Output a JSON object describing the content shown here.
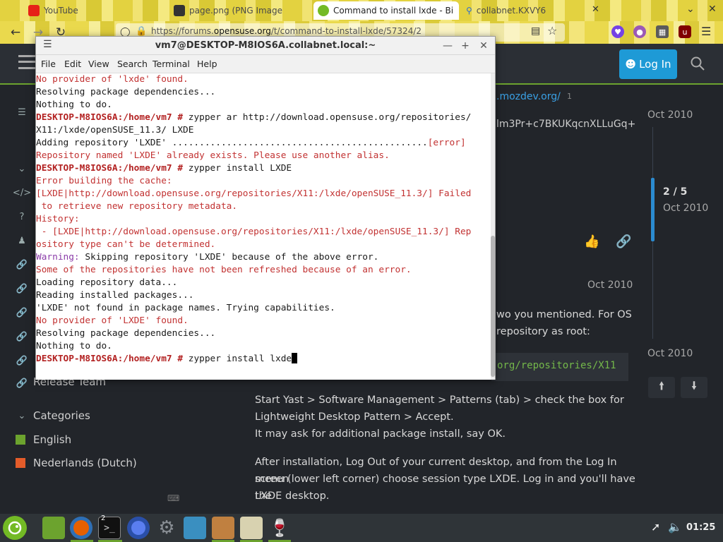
{
  "browser": {
    "tabs": [
      {
        "label": "YouTube",
        "icon": "youtube-icon",
        "active": false
      },
      {
        "label": "page.png (PNG Image",
        "icon": "image-icon",
        "active": false
      },
      {
        "label": "Command to install lxde - Bi",
        "icon": "opensuse-icon",
        "active": true
      },
      {
        "label": "collabnet.KXVY6",
        "icon": "search-icon",
        "active": false
      }
    ],
    "url_prefix": "https://forums.",
    "url_domain": "opensuse.org",
    "url_suffix": "/t/command-to-install-lxde/57324/2"
  },
  "forum": {
    "login_label": "Log In",
    "fragment_link": ".mozdev.org/",
    "fragment_link_count": "1",
    "fragment_key": "lm3Pr+c7BKUKqcnXLLuGq+",
    "timeline_date_top": "Oct 2010",
    "timeline_position": "2 / 5",
    "timeline_position_date": "Oct 2010",
    "post_date": "Oct 2010",
    "timeline_date_bottom": "Oct 2010",
    "frag_line1": "wo you mentioned. For OS",
    "frag_line2": "repository as root:",
    "code_fragment": "org/repositories/X11",
    "sidebar_release_team": "Release Team",
    "categories_label": "Categories",
    "categories": [
      {
        "label": "English",
        "color": "#6ca32e"
      },
      {
        "label": "Nederlands (Dutch)",
        "color": "#e45c2a"
      }
    ],
    "post_paragraphs": [
      "Start Yast > Software Management > Patterns (tab) > check the box for",
      "Lightweight Desktop Pattern > Accept.",
      "It may ask for additional package install, say OK.",
      "After installation, Log Out of your current desktop, and from the Log In screen",
      "menu (lower left corner) choose session type LXDE. Log in and you'll have the",
      "LXDE desktop."
    ]
  },
  "terminal": {
    "title": "vm7@DESKTOP-M8IOS6A.collabnet.local:~",
    "menu": [
      "File",
      "Edit",
      "View",
      "Search",
      "Terminal",
      "Help"
    ],
    "lines": [
      {
        "t": "No provider of 'lxde' found.",
        "c": "red"
      },
      {
        "t": "Resolving package dependencies...",
        "c": "dark"
      },
      {
        "t": "Nothing to do.",
        "c": "dark"
      },
      {
        "p": "DESKTOP-M8IOS6A:/home/vm7 # ",
        "t": "zypper ar http://download.opensuse.org/repositories/",
        "c": "dark"
      },
      {
        "t": "X11:/lxde/openSUSE_11.3/ LXDE",
        "c": "dark"
      },
      {
        "t": "Adding repository 'LXDE' ...............................................",
        "c": "dark",
        "tail": "[error]"
      },
      {
        "t": "Repository named 'LXDE' already exists. Please use another alias.",
        "c": "red"
      },
      {
        "p": "DESKTOP-M8IOS6A:/home/vm7 # ",
        "t": "zypper install LXDE",
        "c": "dark"
      },
      {
        "t": "Error building the cache:",
        "c": "red"
      },
      {
        "t": "[LXDE|http://download.opensuse.org/repositories/X11:/lxde/openSUSE_11.3/] Failed",
        "c": "red"
      },
      {
        "t": " to retrieve new repository metadata.",
        "c": "red"
      },
      {
        "t": "History:",
        "c": "red"
      },
      {
        "t": " - [LXDE|http://download.opensuse.org/repositories/X11:/lxde/openSUSE_11.3/] Rep",
        "c": "red"
      },
      {
        "t": "ository type can't be determined.",
        "c": "red"
      },
      {
        "w": "Warning: ",
        "t": "Skipping repository 'LXDE' because of the above error.",
        "c": "dark"
      },
      {
        "t": "Some of the repositories have not been refreshed because of an error.",
        "c": "red"
      },
      {
        "t": "Loading repository data...",
        "c": "dark"
      },
      {
        "t": "Reading installed packages...",
        "c": "dark"
      },
      {
        "t": "'LXDE' not found in package names. Trying capabilities.",
        "c": "dark"
      },
      {
        "t": "No provider of 'LXDE' found.",
        "c": "red"
      },
      {
        "t": "Resolving package dependencies...",
        "c": "dark"
      },
      {
        "t": "Nothing to do.",
        "c": "dark"
      },
      {
        "p": "DESKTOP-M8IOS6A:/home/vm7 # ",
        "t": "zypper install lxde",
        "c": "dark",
        "cursor": true
      }
    ]
  },
  "taskbar": {
    "clock": "01:25",
    "terminal_count": "2"
  }
}
